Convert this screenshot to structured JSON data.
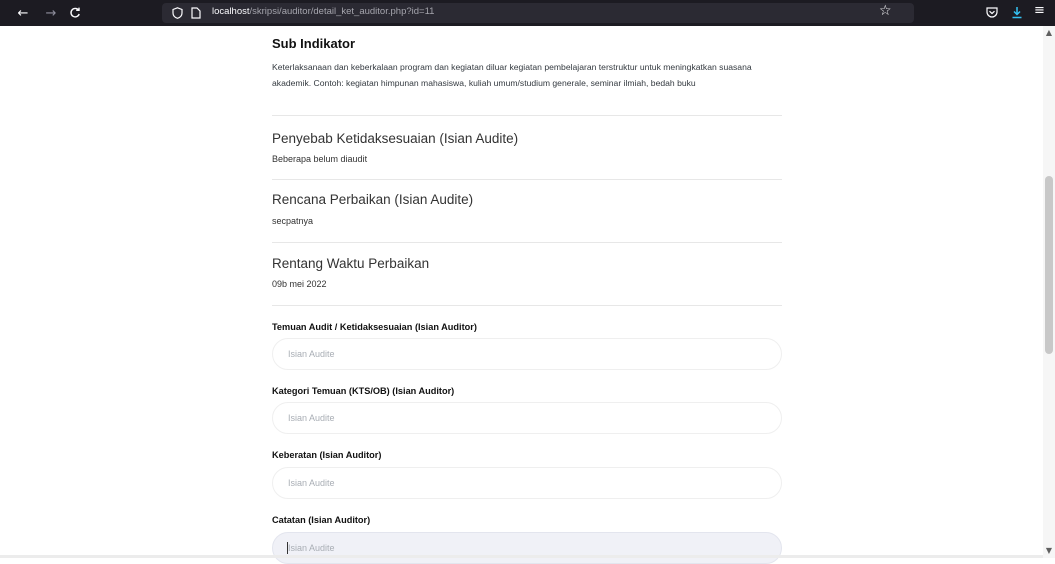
{
  "browser": {
    "url_host": "localhost",
    "url_path": "/skripsi/auditor/detail_ket_auditor.php?id=11",
    "icons": {
      "back": "arrow-left-icon",
      "forward": "arrow-right-icon",
      "reload": "reload-icon",
      "shield": "tracking-protection-icon",
      "page": "page-icon",
      "bookmark": "star-icon",
      "pocket": "pocket-icon",
      "downloads": "download-icon",
      "menu": "hamburger-menu-icon"
    },
    "colors": {
      "chrome_bg": "#1c1b22",
      "urlbar_bg": "#2b2a33",
      "download_accent": "#34c1f2"
    }
  },
  "page": {
    "sub_indikator": {
      "title": "Sub Indikator",
      "text": "Keterlaksanaan dan keberkalaan program dan kegiatan diluar kegiatan pembelajaran terstruktur untuk meningkatkan suasana akademik. Contoh: kegiatan himpunan mahasiswa, kuliah umum/studium generale, seminar ilmiah, bedah buku"
    },
    "sections": [
      {
        "title": "Penyebab Ketidaksesuaian (Isian Audite)",
        "value": "Beberapa belum diaudit"
      },
      {
        "title": "Rencana Perbaikan (Isian Audite)",
        "value": "secpatnya"
      },
      {
        "title": "Rentang Waktu Perbaikan",
        "value": "09b mei 2022"
      }
    ],
    "fields": [
      {
        "label": "Temuan Audit / Ketidaksesuaian (Isian Auditor)",
        "placeholder": "Isian Audite"
      },
      {
        "label": "Kategori Temuan (KTS/OB) (Isian Auditor)",
        "placeholder": "Isian Audite"
      },
      {
        "label": "Keberatan (Isian Auditor)",
        "placeholder": "Isian Audite"
      },
      {
        "label": "Catatan (Isian Auditor)",
        "placeholder": "Isian Audite"
      }
    ]
  }
}
